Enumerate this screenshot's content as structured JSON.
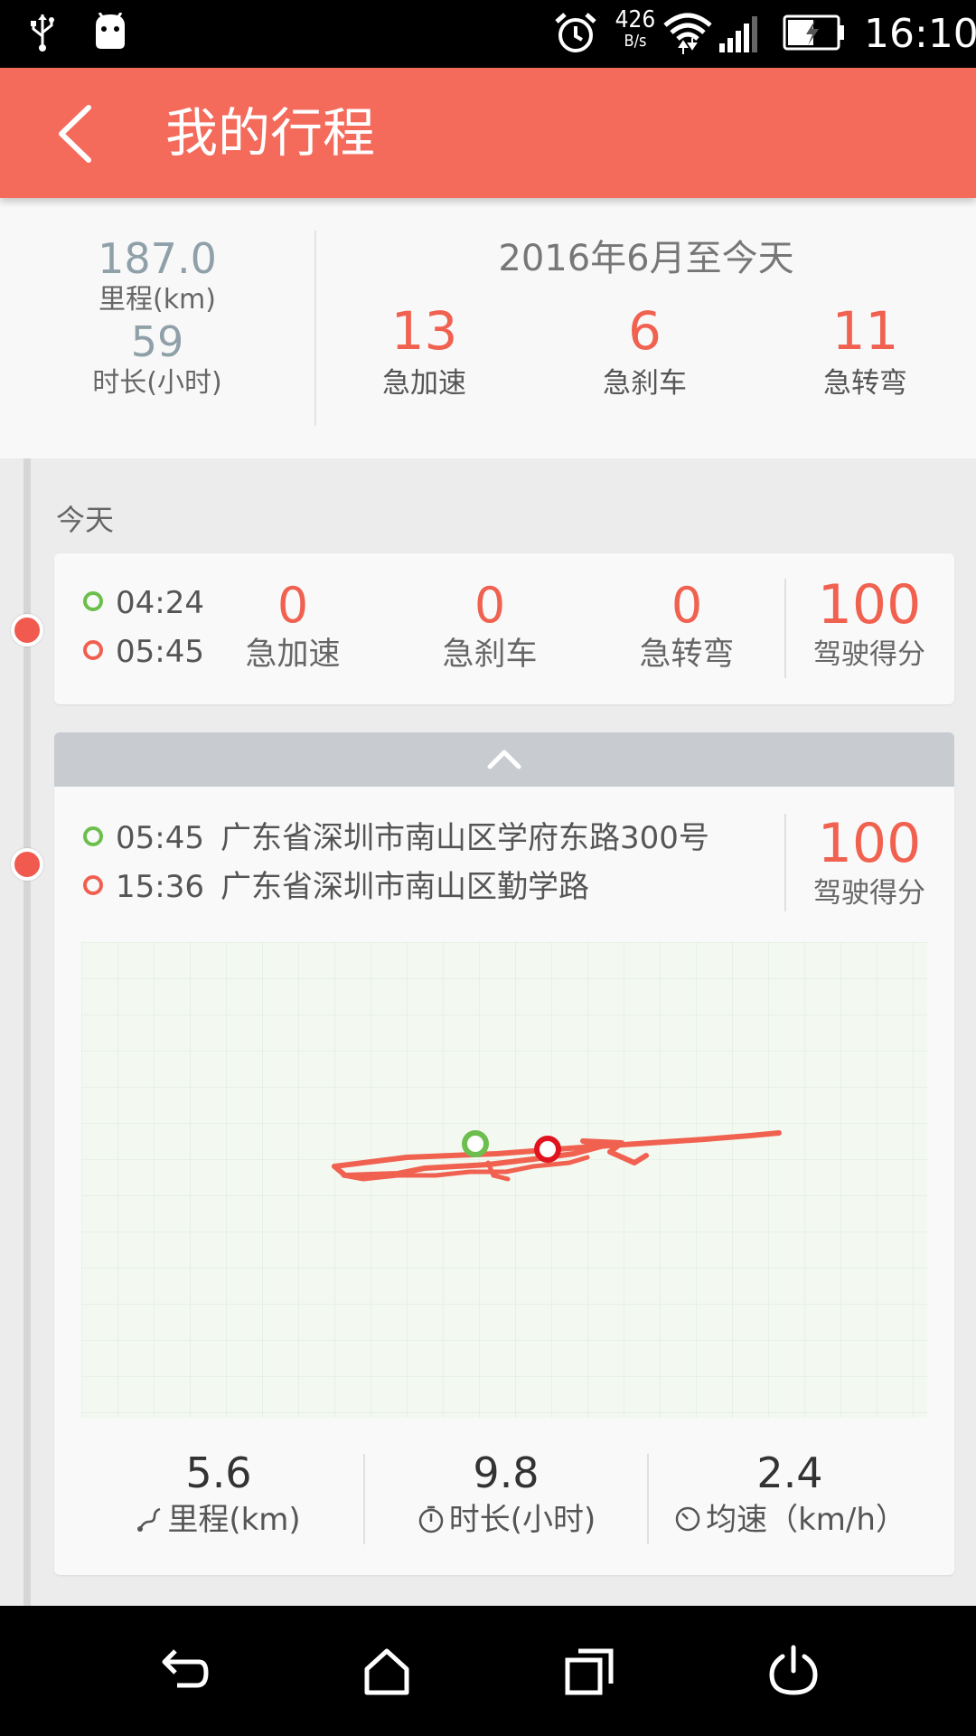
{
  "status_bar": {
    "net_speed": "426",
    "net_speed_unit": "B/s",
    "time": "16:10"
  },
  "header": {
    "title": "我的行程"
  },
  "summary": {
    "distance_value": "187.0",
    "distance_label": "里程(km)",
    "duration_value": "59",
    "duration_label": "时长(小时)",
    "period": "2016年6月至今天",
    "stats": [
      {
        "value": "13",
        "label": "急加速"
      },
      {
        "value": "6",
        "label": "急刹车"
      },
      {
        "value": "11",
        "label": "急转弯"
      }
    ]
  },
  "day_label": "今天",
  "trip1": {
    "start_time": "04:24",
    "end_time": "05:45",
    "stats": [
      {
        "value": "0",
        "label": "急加速"
      },
      {
        "value": "0",
        "label": "急刹车"
      },
      {
        "value": "0",
        "label": "急转弯"
      }
    ],
    "score": "100",
    "score_label": "驾驶得分"
  },
  "trip2": {
    "start_time": "05:45",
    "start_address": "广东省深圳市南山区学府东路300号",
    "end_time": "15:36",
    "end_address": "广东省深圳市南山区勤学路",
    "score": "100",
    "score_label": "驾驶得分",
    "distance_value": "5.6",
    "distance_label": "里程(km)",
    "duration_value": "9.8",
    "duration_label": "时长(小时)",
    "speed_value": "2.4",
    "speed_label": "均速（km/h）"
  },
  "colors": {
    "accent": "#f46a5b",
    "stat_red": "#f06150",
    "start_green": "#6cbf4c",
    "route": "#f06150"
  },
  "icons": [
    "usb-icon",
    "android-icon",
    "alarm-icon",
    "wifi-icon",
    "signal-icon",
    "battery-charging-icon",
    "back-icon",
    "chevron-up-icon",
    "route-icon",
    "timer-icon",
    "speed-icon",
    "nav-back-icon",
    "nav-home-icon",
    "nav-recents-icon",
    "nav-power-icon"
  ]
}
